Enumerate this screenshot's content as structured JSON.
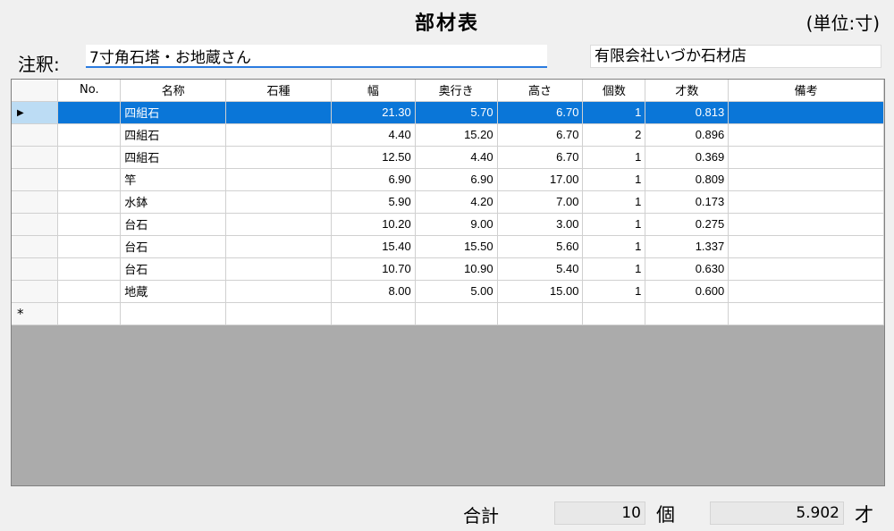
{
  "title": "部材表",
  "unit_note": "(単位:寸)",
  "note_label": "注釈:",
  "note_value": "7寸角石塔・お地蔵さん",
  "company": "有限会社いづか石材店",
  "columns": [
    "No.",
    "名称",
    "石種",
    "幅",
    "奥行き",
    "高さ",
    "個数",
    "才数",
    "備考"
  ],
  "rows": [
    {
      "no": "",
      "name": "四組石",
      "stone": "",
      "width": "21.30",
      "depth": "5.70",
      "height": "6.70",
      "count": "1",
      "sai": "0.813",
      "remarks": ""
    },
    {
      "no": "",
      "name": "四組石",
      "stone": "",
      "width": "4.40",
      "depth": "15.20",
      "height": "6.70",
      "count": "2",
      "sai": "0.896",
      "remarks": ""
    },
    {
      "no": "",
      "name": "四組石",
      "stone": "",
      "width": "12.50",
      "depth": "4.40",
      "height": "6.70",
      "count": "1",
      "sai": "0.369",
      "remarks": ""
    },
    {
      "no": "",
      "name": "竿",
      "stone": "",
      "width": "6.90",
      "depth": "6.90",
      "height": "17.00",
      "count": "1",
      "sai": "0.809",
      "remarks": ""
    },
    {
      "no": "",
      "name": "水鉢",
      "stone": "",
      "width": "5.90",
      "depth": "4.20",
      "height": "7.00",
      "count": "1",
      "sai": "0.173",
      "remarks": ""
    },
    {
      "no": "",
      "name": "台石",
      "stone": "",
      "width": "10.20",
      "depth": "9.00",
      "height": "3.00",
      "count": "1",
      "sai": "0.275",
      "remarks": ""
    },
    {
      "no": "",
      "name": "台石",
      "stone": "",
      "width": "15.40",
      "depth": "15.50",
      "height": "5.60",
      "count": "1",
      "sai": "1.337",
      "remarks": ""
    },
    {
      "no": "",
      "name": "台石",
      "stone": "",
      "width": "10.70",
      "depth": "10.90",
      "height": "5.40",
      "count": "1",
      "sai": "0.630",
      "remarks": ""
    },
    {
      "no": "",
      "name": "地蔵",
      "stone": "",
      "width": "8.00",
      "depth": "5.00",
      "height": "15.00",
      "count": "1",
      "sai": "0.600",
      "remarks": ""
    }
  ],
  "selected_row": 0,
  "current_row_marker": "▶",
  "new_row_marker": "*",
  "total_label": "合計",
  "total_count": "10",
  "count_unit": "個",
  "total_sai": "5.902",
  "sai_unit": "才",
  "colors": {
    "selection": "#0a76d8",
    "row_header_selected": "#bcdcf4",
    "grid_empty": "#ababab",
    "note_underline": "#2a7be0"
  }
}
